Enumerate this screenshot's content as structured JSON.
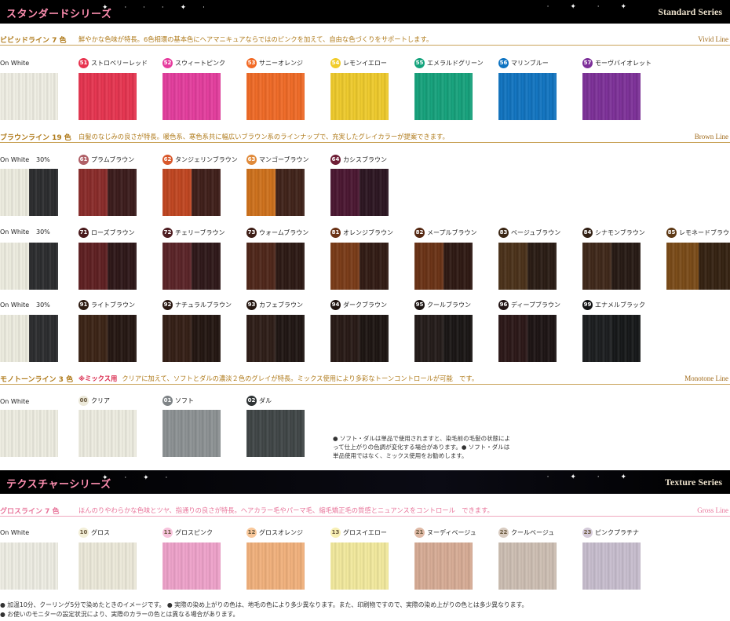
{
  "standard": {
    "jp": "スタンダードシリーズ",
    "en": "Standard Series",
    "stars_left": "✦ · · · ✦ ·",
    "stars_right": "· ✦ · ✦"
  },
  "vivid": {
    "title": "ビビッドライン 7 色",
    "desc": "鮮やかな色味が特長。6色相環の基本色にヘアマニキュアならではのピンクを加えて、自由な色づくりをサポートします。",
    "en": "Vivid Line",
    "onwhite": "On White",
    "base_color": "#f2f1e6",
    "items": [
      {
        "num": "51",
        "name": "ストロベリーレッド",
        "color": "#e8334f"
      },
      {
        "num": "52",
        "name": "スウィートピンク",
        "color": "#e63c9e"
      },
      {
        "num": "53",
        "name": "サニーオレンジ",
        "color": "#f26a25"
      },
      {
        "num": "54",
        "name": "レモンイエロー",
        "color": "#f1cc2a"
      },
      {
        "num": "55",
        "name": "エメラルドグリーン",
        "color": "#14a37c"
      },
      {
        "num": "56",
        "name": "マリンブルー",
        "color": "#0f74c2"
      },
      {
        "num": "57",
        "name": "モーヴバイオレット",
        "color": "#7d2f99"
      }
    ]
  },
  "brown": {
    "title": "ブラウンライン 19 色",
    "desc": "白髪のなじみの良さが特長。暖色系、寒色系共に幅広いブラウン系のラインナップで、充実したグレイカラーが提案できます。",
    "en": "Brown Line",
    "onwhite": "On White",
    "pct": "30%",
    "white_color": "#f0efe2",
    "gray_color": "#2a2b2d",
    "rows": [
      [
        {
          "num": "61",
          "name": "プラムブラウン",
          "color": "#8a2a28",
          "color30": "#3a1a1a",
          "badge": "#b06067"
        },
        {
          "num": "62",
          "name": "タンジェリンブラウン",
          "color": "#c2451f",
          "color30": "#3e1d18",
          "badge": "#d8582b"
        },
        {
          "num": "63",
          "name": "マンゴーブラウン",
          "color": "#d0711a",
          "color30": "#3f2118",
          "badge": "#e08a3a"
        },
        {
          "num": "64",
          "name": "カシスブラウン",
          "color": "#4a1530",
          "color30": "#2b1420",
          "badge": "#6e1e36"
        }
      ],
      [
        {
          "num": "71",
          "name": "ローズブラウン",
          "color": "#5e1e20",
          "color30": "#2c1516",
          "badge": "#4a1a1c"
        },
        {
          "num": "72",
          "name": "チェリーブラウン",
          "color": "#5a2226",
          "color30": "#2d1617",
          "badge": "#4f1e22"
        },
        {
          "num": "73",
          "name": "ウォームブラウン",
          "color": "#4e2518",
          "color30": "#2b1712",
          "badge": "#3e1e16"
        },
        {
          "num": "81",
          "name": "オレンジブラウン",
          "color": "#7a3a16",
          "color30": "#301912",
          "badge": "#6a3216"
        },
        {
          "num": "82",
          "name": "メープルブラウン",
          "color": "#6a3114",
          "color30": "#2d1711",
          "badge": "#552812"
        },
        {
          "num": "83",
          "name": "ベージュブラウン",
          "color": "#4a3018",
          "color30": "#281a12",
          "badge": "#3b2614"
        },
        {
          "num": "84",
          "name": "シナモンブラウン",
          "color": "#3e2618",
          "color30": "#251812",
          "badge": "#322014"
        },
        {
          "num": "85",
          "name": "レモネードブラウン",
          "color": "#7a4a16",
          "color30": "#33200f",
          "badge": "#5e3a16"
        }
      ],
      [
        {
          "num": "91",
          "name": "ライトブラウン",
          "color": "#3a2214",
          "color30": "#231510",
          "badge": "#2e1c12"
        },
        {
          "num": "92",
          "name": "ナチュラルブラウン",
          "color": "#331d14",
          "color30": "#21140f",
          "badge": "#2a1812"
        },
        {
          "num": "93",
          "name": "カフェブラウン",
          "color": "#2d1c16",
          "color30": "#1e1411",
          "badge": "#261812"
        },
        {
          "num": "94",
          "name": "ダークブラウン",
          "color": "#261814",
          "color30": "#1b1310",
          "badge": "#201410"
        },
        {
          "num": "95",
          "name": "クールブラウン",
          "color": "#221a18",
          "color30": "#181413",
          "badge": "#1e1614"
        },
        {
          "num": "96",
          "name": "ディープブラウン",
          "color": "#2a1616",
          "color30": "#1b1212",
          "badge": "#221414"
        },
        {
          "num": "99",
          "name": "エナメルブラック",
          "color": "#1a1c1e",
          "color30": "#141617",
          "badge": "#121314"
        }
      ]
    ]
  },
  "monotone": {
    "title": "モノトーンライン 3 色",
    "mix": "※ミックス用",
    "desc": "クリアに加えて、ソフトとダルの濃淡２色のグレイが特長。ミックス使用により多彩なトーンコントロールが可能　です。",
    "en": "Monotone Line",
    "onwhite": "On White",
    "base_color": "#f1f0e4",
    "items": [
      {
        "num": "00",
        "name": "クリア",
        "color": "#f0efe3",
        "badge": "#ece9da"
      },
      {
        "num": "01",
        "name": "ソフト",
        "color": "#8d9294",
        "badge": "#7f8487"
      },
      {
        "num": "02",
        "name": "ダル",
        "color": "#3f4546",
        "badge": "#2f3435"
      }
    ],
    "note": "● ソフト・ダルは単品で使用されますと、染毛前の毛髪の状態によって仕上がりの色調が変化する場合があります。● ソフト・ダルは単品使用ではなく、ミックス使用をお勧めします。"
  },
  "texture": {
    "jp": "テクスチャーシリーズ",
    "en": "Texture Series",
    "stars_left": "✦ · ✦ ·",
    "stars_right": "· ✦ · ✦"
  },
  "gross": {
    "title": "グロスライン 7 色",
    "desc": "ほんのりやわらかな色味とツヤ、指通りの良さが特長。ヘアカラー毛やパーマ毛、縮毛矯正毛の質感とニュアンスをコントロール　できます。",
    "en": "Gross Line",
    "onwhite": "On White",
    "base_color": "#f1f0e6",
    "items": [
      {
        "num": "10",
        "name": "グロス",
        "color": "#efecdc",
        "badge": "#f3efd8"
      },
      {
        "num": "11",
        "name": "グロスピンク",
        "color": "#f1a3cc",
        "badge": "#f7c3dc"
      },
      {
        "num": "12",
        "name": "グロスオレンジ",
        "color": "#f4b27c",
        "badge": "#f8c79a"
      },
      {
        "num": "13",
        "name": "グロスイエロー",
        "color": "#f5ec9e",
        "badge": "#f7efb4"
      },
      {
        "num": "21",
        "name": "ヌーディベージュ",
        "color": "#d9ad96",
        "badge": "#dfb9a5"
      },
      {
        "num": "22",
        "name": "クールベージュ",
        "color": "#cfc0b4",
        "badge": "#d8cbc0"
      },
      {
        "num": "23",
        "name": "ピンクプラチナ",
        "color": "#c9bfd0",
        "badge": "#d4cad9"
      }
    ]
  },
  "footer": {
    "line1": "● 加温10分、クーリング5分で染めたときのイメージです。 ● 実際の染め上がりの色は、地毛の色により多少異なります。また、印刷物ですので、実際の染め上がりの色とは多少異なります。",
    "line2": "● お使いのモニターの設定状況により、実際のカラーの色とは異なる場合があります。"
  }
}
